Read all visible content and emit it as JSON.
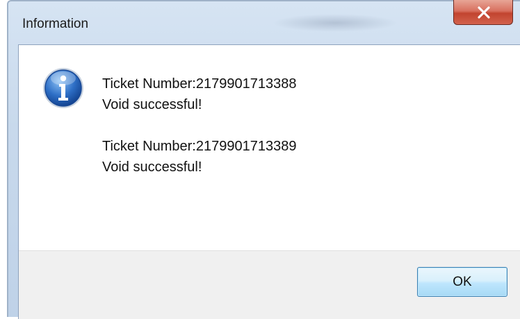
{
  "dialog": {
    "title": "Information",
    "close_label": "Close",
    "icon": "info-icon",
    "messages": [
      {
        "ticket": "Ticket Number:2179901713388",
        "status": "Void successful!"
      },
      {
        "ticket": "Ticket Number:2179901713389",
        "status": "Void successful!"
      }
    ],
    "ok_label": "OK"
  },
  "colors": {
    "titlebar": "#c8d9ec",
    "close_button": "#c2442f",
    "ok_border": "#3c7fb1",
    "info_icon": "#1f5fb8"
  }
}
